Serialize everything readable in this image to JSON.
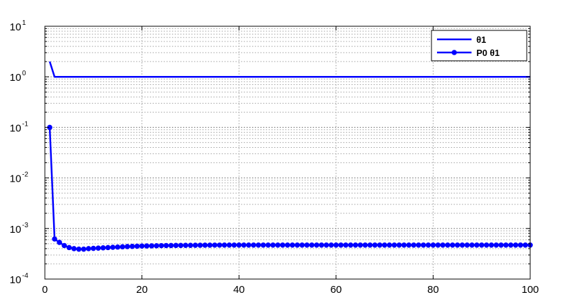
{
  "chart_data": {
    "type": "line",
    "xlim": [
      0,
      100
    ],
    "ylim": [
      0.0001,
      10
    ],
    "yscale": "log",
    "grid": true,
    "legend_placement": "top-right",
    "x_ticks": [
      "0",
      "20",
      "40",
      "60",
      "80",
      "100"
    ],
    "y_ticks": [
      {
        "base": "10",
        "exp": "-4"
      },
      {
        "base": "10",
        "exp": "-3"
      },
      {
        "base": "10",
        "exp": "-2"
      },
      {
        "base": "10",
        "exp": "-1"
      },
      {
        "base": "10",
        "exp": "0"
      },
      {
        "base": "10",
        "exp": "1"
      }
    ],
    "series": [
      {
        "name": "θ1",
        "color": "#0000ff",
        "marker": "none",
        "points": [
          [
            1,
            2.0
          ],
          [
            2,
            1.0
          ],
          [
            100,
            1.0
          ]
        ]
      },
      {
        "name": "P0 θ1",
        "color": "#0000ff",
        "marker": "circle",
        "x": [
          1,
          2,
          3,
          4,
          5,
          6,
          7,
          8,
          9,
          10,
          11,
          12,
          13,
          14,
          15,
          16,
          17,
          18,
          19,
          20,
          21,
          22,
          23,
          24,
          25,
          26,
          27,
          28,
          29,
          30,
          31,
          32,
          33,
          34,
          35,
          36,
          37,
          38,
          39,
          40,
          41,
          42,
          43,
          44,
          45,
          46,
          47,
          48,
          49,
          50,
          51,
          52,
          53,
          54,
          55,
          56,
          57,
          58,
          59,
          60,
          61,
          62,
          63,
          64,
          65,
          66,
          67,
          68,
          69,
          70,
          71,
          72,
          73,
          74,
          75,
          76,
          77,
          78,
          79,
          80,
          81,
          82,
          83,
          84,
          85,
          86,
          87,
          88,
          89,
          90,
          91,
          92,
          93,
          94,
          95,
          96,
          97,
          98,
          99,
          100
        ],
        "y": [
          0.1,
          0.00062,
          0.00053,
          0.00046,
          0.00042,
          0.0004,
          0.00039,
          0.00039,
          0.0004,
          0.000405,
          0.00041,
          0.000415,
          0.00042,
          0.000425,
          0.00043,
          0.000435,
          0.00044,
          0.000443,
          0.000446,
          0.00045,
          0.000452,
          0.000454,
          0.000456,
          0.000458,
          0.00046,
          0.000461,
          0.000462,
          0.000463,
          0.000464,
          0.000465,
          0.000466,
          0.000467,
          0.000468,
          0.000468,
          0.000469,
          0.000469,
          0.00047,
          0.00047,
          0.00047,
          0.00047,
          0.00047,
          0.00047,
          0.00047,
          0.00047,
          0.00047,
          0.00047,
          0.00047,
          0.00047,
          0.00047,
          0.00047,
          0.00047,
          0.00047,
          0.00047,
          0.00047,
          0.00047,
          0.00047,
          0.00047,
          0.00047,
          0.00047,
          0.00047,
          0.00047,
          0.00047,
          0.00047,
          0.00047,
          0.00047,
          0.00047,
          0.00047,
          0.00047,
          0.00047,
          0.00047,
          0.00047,
          0.00047,
          0.00047,
          0.00047,
          0.00047,
          0.00047,
          0.00047,
          0.00047,
          0.00047,
          0.00047,
          0.00047,
          0.00047,
          0.00047,
          0.00047,
          0.00047,
          0.00047,
          0.00047,
          0.00047,
          0.00047,
          0.00047,
          0.00047,
          0.00047,
          0.00047,
          0.00047,
          0.00047,
          0.00047,
          0.00047,
          0.00047,
          0.00047,
          0.00047
        ]
      }
    ]
  }
}
